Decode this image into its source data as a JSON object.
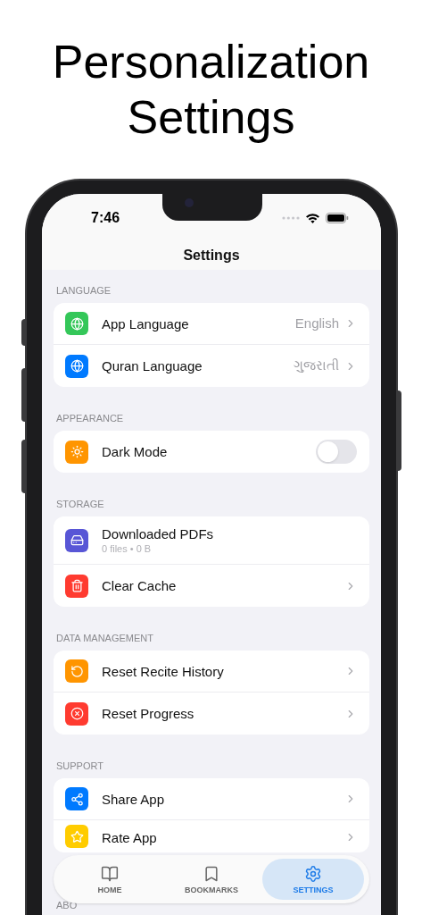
{
  "headline": "Personalization Settings",
  "status_bar": {
    "time": "7:46"
  },
  "nav_title": "Settings",
  "sections": [
    {
      "title": "LANGUAGE",
      "rows": [
        {
          "kind": "link",
          "color": "#34c759",
          "label": "App Language",
          "value": "English"
        },
        {
          "kind": "link",
          "color": "#007aff",
          "label": "Quran Language",
          "value": "ગુજરાતી"
        }
      ]
    },
    {
      "title": "APPEARANCE",
      "rows": [
        {
          "kind": "toggle",
          "color": "#ff9500",
          "label": "Dark Mode",
          "on": false
        }
      ]
    },
    {
      "title": "STORAGE",
      "rows": [
        {
          "kind": "info",
          "color": "#5856d6",
          "label": "Downloaded PDFs",
          "subtitle": "0 files • 0 B"
        },
        {
          "kind": "link",
          "color": "#ff3b30",
          "label": "Clear Cache"
        }
      ]
    },
    {
      "title": "DATA MANAGEMENT",
      "rows": [
        {
          "kind": "link",
          "color": "#ff9500",
          "label": "Reset Recite History"
        },
        {
          "kind": "link",
          "color": "#ff3b30",
          "label": "Reset Progress"
        }
      ]
    },
    {
      "title": "SUPPORT",
      "rows": [
        {
          "kind": "link",
          "color": "#007aff",
          "label": "Share App"
        },
        {
          "kind": "link",
          "color": "#ffcc00",
          "label": "Rate App"
        }
      ]
    },
    {
      "title": "ABO"
    }
  ],
  "tabs": [
    {
      "label": "HOME",
      "selected": false
    },
    {
      "label": "BOOKMARKS",
      "selected": false
    },
    {
      "label": "SETTINGS",
      "selected": true
    }
  ]
}
